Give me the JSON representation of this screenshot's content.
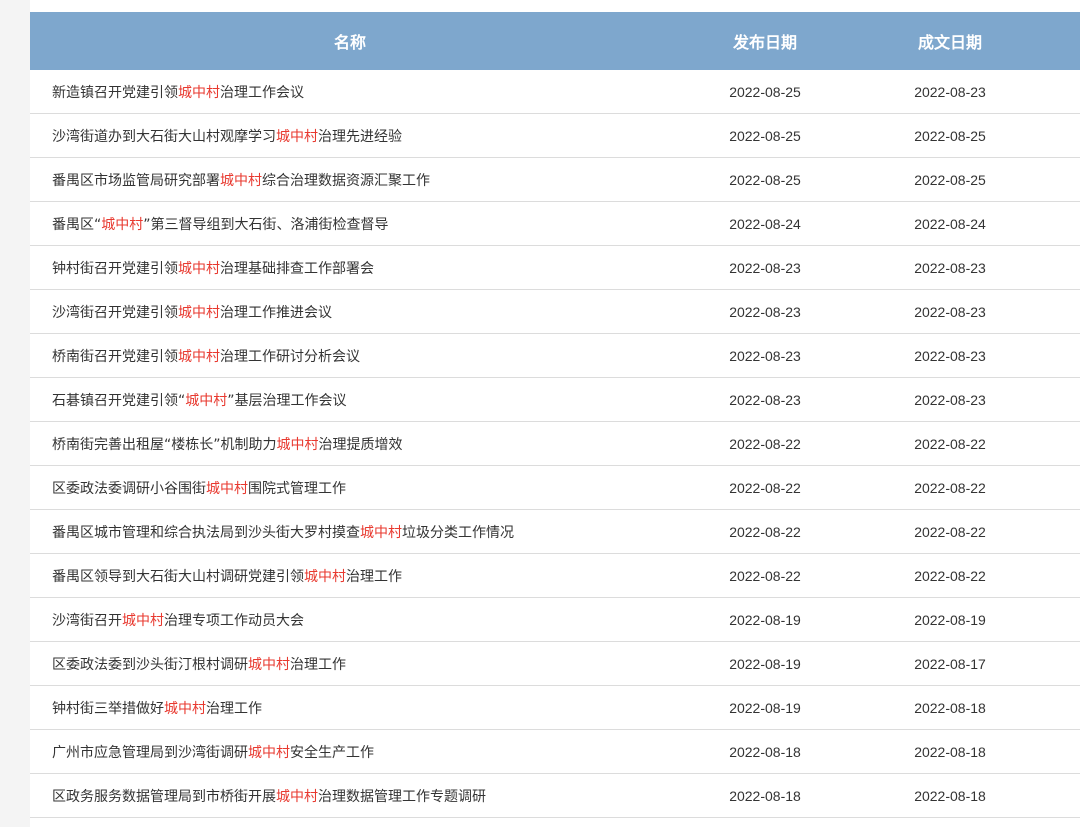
{
  "table": {
    "headers": {
      "name": "名称",
      "publish_date": "发布日期",
      "written_date": "成文日期"
    },
    "rows": [
      {
        "pre": "新造镇召开党建引领",
        "hl": "城中村",
        "post": "治理工作会议",
        "publish": "2022-08-25",
        "written": "2022-08-23"
      },
      {
        "pre": "沙湾街道办到大石街大山村观摩学习",
        "hl": "城中村",
        "post": "治理先进经验",
        "publish": "2022-08-25",
        "written": "2022-08-25"
      },
      {
        "pre": "番禺区市场监管局研究部署",
        "hl": "城中村",
        "post": "综合治理数据资源汇聚工作",
        "publish": "2022-08-25",
        "written": "2022-08-25"
      },
      {
        "pre": "番禺区“",
        "hl": "城中村",
        "post": "”第三督导组到大石街、洛浦街检查督导",
        "publish": "2022-08-24",
        "written": "2022-08-24"
      },
      {
        "pre": "钟村街召开党建引领",
        "hl": "城中村",
        "post": "治理基础排查工作部署会",
        "publish": "2022-08-23",
        "written": "2022-08-23"
      },
      {
        "pre": "沙湾街召开党建引领",
        "hl": "城中村",
        "post": "治理工作推进会议",
        "publish": "2022-08-23",
        "written": "2022-08-23"
      },
      {
        "pre": "桥南街召开党建引领",
        "hl": "城中村",
        "post": "治理工作研讨分析会议",
        "publish": "2022-08-23",
        "written": "2022-08-23"
      },
      {
        "pre": "石碁镇召开党建引领“",
        "hl": "城中村",
        "post": "”基层治理工作会议",
        "publish": "2022-08-23",
        "written": "2022-08-23"
      },
      {
        "pre": "桥南街完善出租屋“楼栋长”机制助力",
        "hl": "城中村",
        "post": "治理提质增效",
        "publish": "2022-08-22",
        "written": "2022-08-22"
      },
      {
        "pre": "区委政法委调研小谷围街",
        "hl": "城中村",
        "post": "围院式管理工作",
        "publish": "2022-08-22",
        "written": "2022-08-22"
      },
      {
        "pre": "番禺区城市管理和综合执法局到沙头街大罗村摸查",
        "hl": "城中村",
        "post": "垃圾分类工作情况",
        "publish": "2022-08-22",
        "written": "2022-08-22"
      },
      {
        "pre": "番禺区领导到大石街大山村调研党建引领",
        "hl": "城中村",
        "post": "治理工作",
        "publish": "2022-08-22",
        "written": "2022-08-22"
      },
      {
        "pre": "沙湾街召开",
        "hl": "城中村",
        "post": "治理专项工作动员大会",
        "publish": "2022-08-19",
        "written": "2022-08-19"
      },
      {
        "pre": "区委政法委到沙头街汀根村调研",
        "hl": "城中村",
        "post": "治理工作",
        "publish": "2022-08-19",
        "written": "2022-08-17"
      },
      {
        "pre": "钟村街三举措做好",
        "hl": "城中村",
        "post": "治理工作",
        "publish": "2022-08-19",
        "written": "2022-08-18"
      },
      {
        "pre": "广州市应急管理局到沙湾街调研",
        "hl": "城中村",
        "post": "安全生产工作",
        "publish": "2022-08-18",
        "written": "2022-08-18"
      },
      {
        "pre": "区政务服务数据管理局到市桥街开展",
        "hl": "城中村",
        "post": "治理数据管理工作专题调研",
        "publish": "2022-08-18",
        "written": "2022-08-18"
      }
    ]
  },
  "colors": {
    "header_bg": "#7ea7cd",
    "highlight": "#e8392f",
    "text": "#333333"
  }
}
